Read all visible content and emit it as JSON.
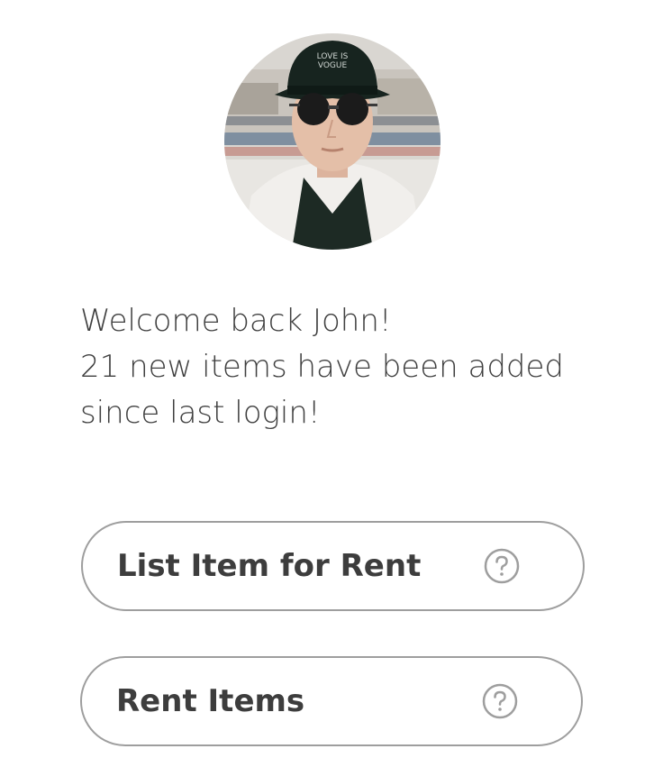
{
  "profile": {
    "avatar_description": "profile-photo"
  },
  "welcome": {
    "line1": "Welcome back John!",
    "line2": "21 new items have been added",
    "line3": "since last login!"
  },
  "buttons": {
    "list_item_label": "List Item for Rent",
    "rent_items_label": "Rent Items",
    "help_icon": "question-circle-icon"
  },
  "colors": {
    "text": "#3d3d3d",
    "button_border": "#9e9e9e",
    "icon": "#9e9e9e",
    "background": "#ffffff"
  }
}
